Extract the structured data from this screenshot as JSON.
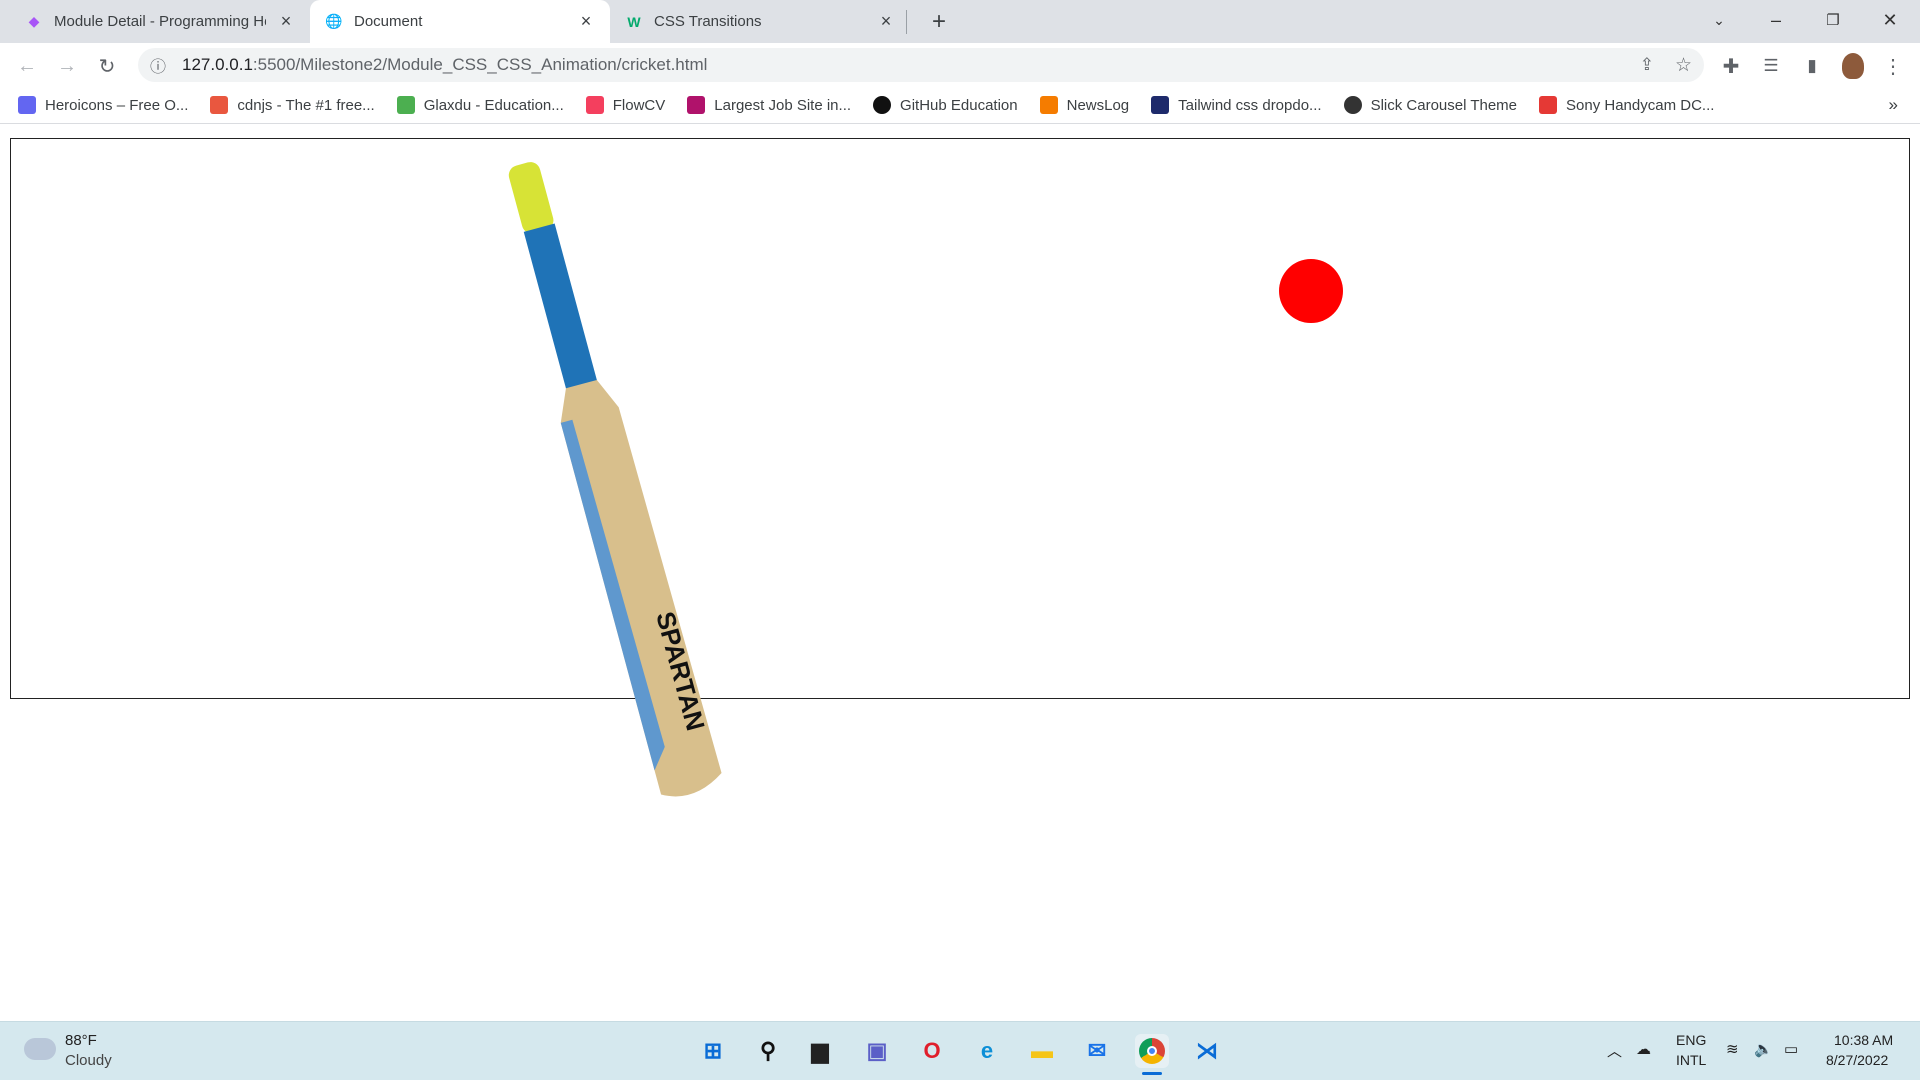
{
  "browser": {
    "tabs": [
      {
        "title": "Module Detail - Programming He",
        "icon": "programming-hero-icon",
        "active": false
      },
      {
        "title": "Document",
        "icon": "globe-icon",
        "active": true
      },
      {
        "title": "CSS Transitions",
        "icon": "w3schools-icon",
        "active": false
      }
    ],
    "new_tab": "+",
    "url_host": "127.0.0.1",
    "url_rest": ":5500/Milestone2/Module_CSS_CSS_Animation/cricket.html",
    "bookmarks": [
      {
        "label": "Heroicons – Free O...",
        "color": "#6366f1"
      },
      {
        "label": "cdnjs - The #1 free...",
        "color": "#e9573f"
      },
      {
        "label": "Glaxdu - Education...",
        "color": "#4caf50"
      },
      {
        "label": "FlowCV",
        "color": "#f43f5e"
      },
      {
        "label": "Largest Job Site in...",
        "color": "#b0126b"
      },
      {
        "label": "GitHub Education",
        "color": "#111111"
      },
      {
        "label": "NewsLog",
        "color": "#f57c00"
      },
      {
        "label": "Tailwind css dropdo...",
        "color": "#1e2a6b"
      },
      {
        "label": "Slick Carousel Theme",
        "color": "#333333"
      },
      {
        "label": "Sony Handycam DC...",
        "color": "#e53935"
      }
    ],
    "more_bookmarks": "»"
  },
  "page": {
    "ball_color": "#ff0000",
    "bat_brand": "SPARTAN"
  },
  "taskbar": {
    "weather_temp": "88°F",
    "weather_desc": "Cloudy",
    "lang1": "ENG",
    "lang2": "INTL",
    "time": "10:38 AM",
    "date": "8/27/2022"
  }
}
